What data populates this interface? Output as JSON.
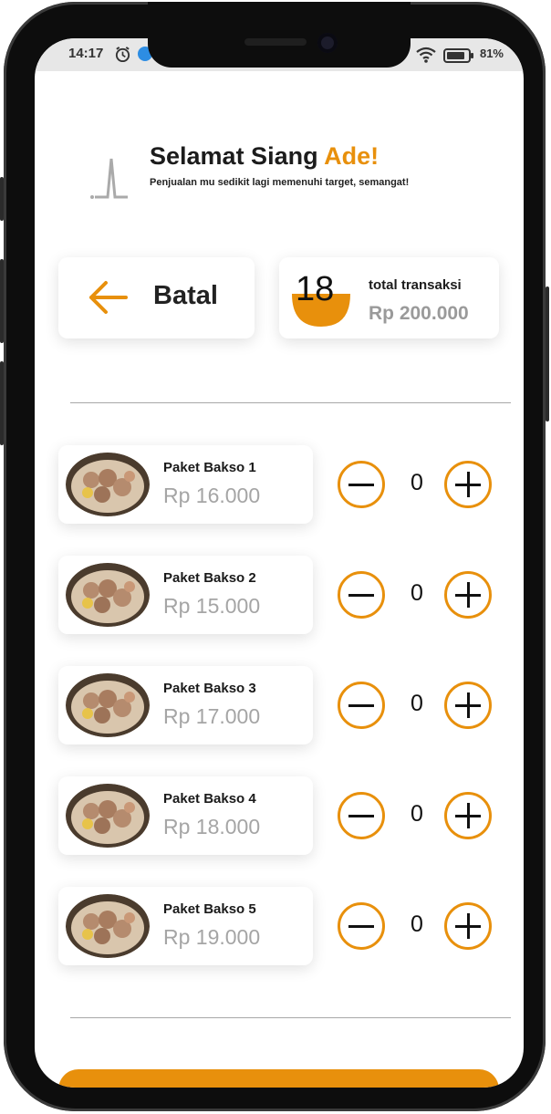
{
  "status_bar": {
    "time": "14:17",
    "battery": "81%"
  },
  "header": {
    "greeting": "Selamat Siang ",
    "name": "Ade!",
    "subtitle": "Penjualan mu sedikit lagi memenuhi target, semangat!"
  },
  "actions": {
    "cancel_label": "Batal"
  },
  "summary": {
    "count": "18",
    "label": "total transaksi",
    "amount": "Rp 200.000"
  },
  "menu": [
    {
      "name": "Paket Bakso 1",
      "price": "Rp 16.000",
      "qty": "0"
    },
    {
      "name": "Paket Bakso 2",
      "price": "Rp 15.000",
      "qty": "0"
    },
    {
      "name": "Paket Bakso 3",
      "price": "Rp 17.000",
      "qty": "0"
    },
    {
      "name": "Paket Bakso 4",
      "price": "Rp 18.000",
      "qty": "0"
    },
    {
      "name": "Paket Bakso 5",
      "price": "Rp 19.000",
      "qty": "0"
    }
  ],
  "colors": {
    "accent": "#e8900c",
    "text": "#1c1c1c",
    "muted": "#a5a5a5"
  },
  "icons": [
    "alarm-icon",
    "app-icon",
    "wifi-icon",
    "battery-icon",
    "logo-icon",
    "arrow-left-icon",
    "bowl-icon",
    "food-image",
    "minus-icon",
    "plus-icon"
  ]
}
